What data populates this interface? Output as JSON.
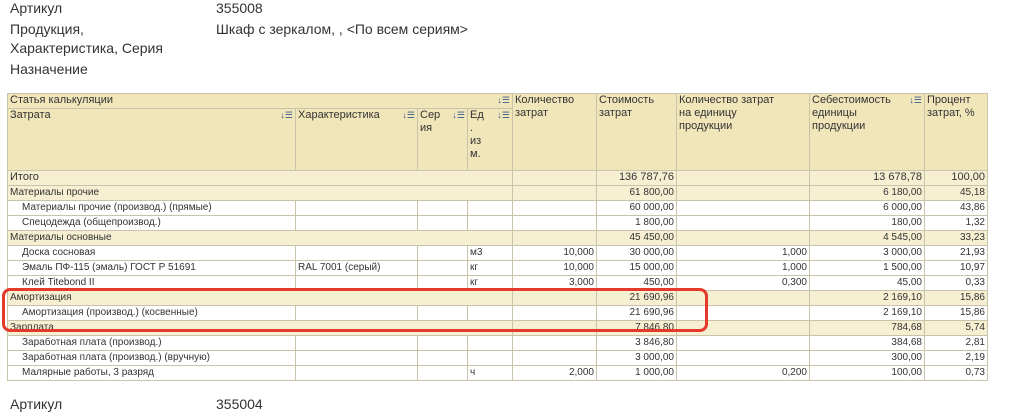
{
  "header": {
    "article_label": "Артикул",
    "article_value": "355008",
    "product_label_1": "Продукция,",
    "product_label_2": "Характеристика, Серия",
    "product_value": "Шкаф с зеркалом, , <По всем сериям>",
    "purpose_label": "Назначение"
  },
  "columns": {
    "group": "Статья калькуляции",
    "cost": "Затрата",
    "char": "Характеристика",
    "series_1": "Сер",
    "series_2": "ия",
    "unit_1": "Ед",
    "unit_2": ".",
    "unit_3": "из",
    "unit_4": "м.",
    "qty_1": "Количество",
    "qty_2": "затрат",
    "value_1": "Стоимость",
    "value_2": "затрат",
    "qtyunit_1": "Количество затрат",
    "qtyunit_2": "на единицу",
    "qtyunit_3": "продукции",
    "self_1": "Себестоимость",
    "self_2": "единицы",
    "self_3": "продукции",
    "pct_1": "Процент",
    "pct_2": "затрат, %"
  },
  "rows": [
    {
      "kind": "total",
      "name": "Итого",
      "char": "",
      "series": "",
      "unit": "",
      "qty": "",
      "value": "136 787,76",
      "qtyunit": "",
      "self": "13 678,78",
      "pct": "100,00"
    },
    {
      "kind": "grp",
      "name": "Материалы прочие",
      "char": "",
      "series": "",
      "unit": "",
      "qty": "",
      "value": "61 800,00",
      "qtyunit": "",
      "self": "6 180,00",
      "pct": "45,18"
    },
    {
      "kind": "item",
      "name": "Материалы прочие (производ.) (прямые)",
      "char": "",
      "series": "",
      "unit": "",
      "qty": "",
      "value": "60 000,00",
      "qtyunit": "",
      "self": "6 000,00",
      "pct": "43,86"
    },
    {
      "kind": "item",
      "name": "Спецодежда (общепроизвод.)",
      "char": "",
      "series": "",
      "unit": "",
      "qty": "",
      "value": "1 800,00",
      "qtyunit": "",
      "self": "180,00",
      "pct": "1,32"
    },
    {
      "kind": "grp",
      "name": "Материалы основные",
      "char": "",
      "series": "",
      "unit": "",
      "qty": "",
      "value": "45 450,00",
      "qtyunit": "",
      "self": "4 545,00",
      "pct": "33,23"
    },
    {
      "kind": "item",
      "name": "Доска сосновая",
      "char": "",
      "series": "",
      "unit": "м3",
      "qty": "10,000",
      "value": "30 000,00",
      "qtyunit": "1,000",
      "self": "3 000,00",
      "pct": "21,93"
    },
    {
      "kind": "item",
      "name": "Эмаль ПФ-115 (эмаль) ГОСТ Р 51691",
      "char": "RAL 7001 (серый)",
      "series": "",
      "unit": "кг",
      "qty": "10,000",
      "value": "15 000,00",
      "qtyunit": "1,000",
      "self": "1 500,00",
      "pct": "10,97"
    },
    {
      "kind": "item",
      "name": "Клей Titebond II",
      "char": "",
      "series": "",
      "unit": "кг",
      "qty": "3,000",
      "value": "450,00",
      "qtyunit": "0,300",
      "self": "45,00",
      "pct": "0,33"
    },
    {
      "kind": "grp",
      "name": "Амортизация",
      "char": "",
      "series": "",
      "unit": "",
      "qty": "",
      "value": "21 690,96",
      "qtyunit": "",
      "self": "2 169,10",
      "pct": "15,86"
    },
    {
      "kind": "item",
      "name": "Амортизация (производ.) (косвенные)",
      "char": "",
      "series": "",
      "unit": "",
      "qty": "",
      "value": "21 690,96",
      "qtyunit": "",
      "self": "2 169,10",
      "pct": "15,86"
    },
    {
      "kind": "grp",
      "name": "Зарплата",
      "char": "",
      "series": "",
      "unit": "",
      "qty": "",
      "value": "7 846,80",
      "qtyunit": "",
      "self": "784,68",
      "pct": "5,74"
    },
    {
      "kind": "item",
      "name": "Заработная плата (производ.)",
      "char": "",
      "series": "",
      "unit": "",
      "qty": "",
      "value": "3 846,80",
      "qtyunit": "",
      "self": "384,68",
      "pct": "2,81"
    },
    {
      "kind": "item",
      "name": "Заработная плата (производ.) (вручную)",
      "char": "",
      "series": "",
      "unit": "",
      "qty": "",
      "value": "3 000,00",
      "qtyunit": "",
      "self": "300,00",
      "pct": "2,19"
    },
    {
      "kind": "item",
      "name": "Малярные работы, 3 разряд",
      "char": "",
      "series": "",
      "unit": "ч",
      "qty": "2,000",
      "value": "1 000,00",
      "qtyunit": "0,200",
      "self": "100,00",
      "pct": "0,73"
    }
  ],
  "footer": {
    "article_label": "Артикул",
    "article_value": "355004"
  },
  "colors": {
    "header_bg": "#f1e6ba",
    "group_bg": "#f6efd2",
    "highlight": "#e33a2b"
  }
}
